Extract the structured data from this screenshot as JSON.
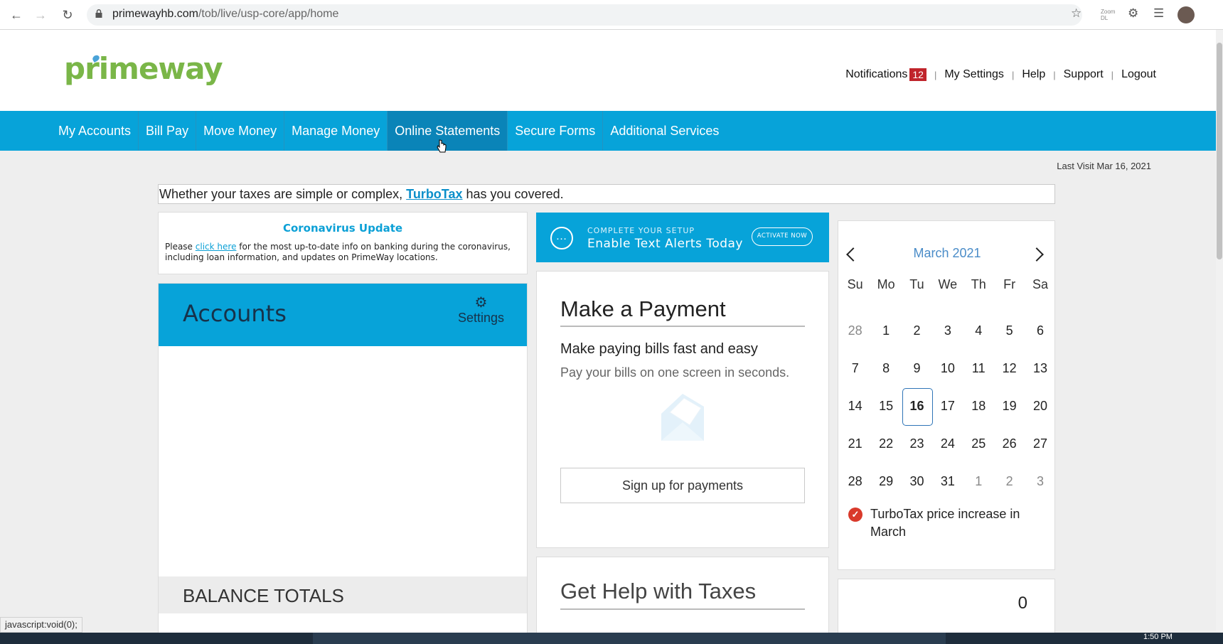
{
  "browser": {
    "url_domain": "primewayhb.com",
    "url_path": "/tob/live/usp-core/app/home",
    "extension_label": "Zoom\nDL"
  },
  "header": {
    "logo_text": "primeway",
    "links": {
      "notifications": "Notifications",
      "notifications_count": "12",
      "my_settings": "My Settings",
      "help": "Help",
      "support": "Support",
      "logout": "Logout"
    }
  },
  "nav": {
    "items": [
      "My Accounts",
      "Bill Pay",
      "Move Money",
      "Manage Money",
      "Online Statements",
      "Secure Forms",
      "Additional Services"
    ],
    "active_index": 4
  },
  "last_visit": "Last Visit Mar 16, 2021",
  "banner": {
    "prefix": "Whether your taxes are simple or complex,",
    "link": "TurboTax",
    "suffix": "has you covered."
  },
  "corona": {
    "title": "Coronavirus Update",
    "text_before": "Please",
    "link": "click here",
    "text_after": "for the most up-to-date info on banking during the coronavirus, including loan information, and updates on PrimeWay locations."
  },
  "accounts": {
    "title": "Accounts",
    "settings_label": "Settings",
    "balance_totals": "BALANCE TOTALS"
  },
  "text_alerts": {
    "small": "COMPLETE YOUR SETUP",
    "big": "Enable Text Alerts Today",
    "button": "ACTIVATE NOW"
  },
  "payment": {
    "title": "Make a Payment",
    "subtitle": "Make paying bills fast and easy",
    "description": "Pay your bills on one screen in seconds.",
    "button": "Sign up for payments"
  },
  "taxes": {
    "title": "Get Help with Taxes"
  },
  "calendar": {
    "month": "March 2021",
    "weekdays": [
      "Su",
      "Mo",
      "Tu",
      "We",
      "Th",
      "Fr",
      "Sa"
    ],
    "days": [
      {
        "d": "28",
        "other": true
      },
      {
        "d": "1"
      },
      {
        "d": "2"
      },
      {
        "d": "3"
      },
      {
        "d": "4"
      },
      {
        "d": "5"
      },
      {
        "d": "6"
      },
      {
        "d": "7"
      },
      {
        "d": "8"
      },
      {
        "d": "9"
      },
      {
        "d": "10"
      },
      {
        "d": "11"
      },
      {
        "d": "12"
      },
      {
        "d": "13"
      },
      {
        "d": "14"
      },
      {
        "d": "15"
      },
      {
        "d": "16",
        "today": true
      },
      {
        "d": "17"
      },
      {
        "d": "18"
      },
      {
        "d": "19"
      },
      {
        "d": "20"
      },
      {
        "d": "21"
      },
      {
        "d": "22"
      },
      {
        "d": "23"
      },
      {
        "d": "24"
      },
      {
        "d": "25"
      },
      {
        "d": "26"
      },
      {
        "d": "27"
      },
      {
        "d": "28"
      },
      {
        "d": "29"
      },
      {
        "d": "30"
      },
      {
        "d": "31"
      },
      {
        "d": "1",
        "other": true
      },
      {
        "d": "2",
        "other": true
      },
      {
        "d": "3",
        "other": true
      }
    ],
    "event": "TurboTax price increase in March"
  },
  "counter_value": "0",
  "status_bar": "javascript:void(0);",
  "taskbar_clock": "1:50 PM",
  "colors": {
    "brand_blue": "#07a3d9",
    "brand_green": "#7ab648",
    "badge_red": "#c0242b"
  }
}
